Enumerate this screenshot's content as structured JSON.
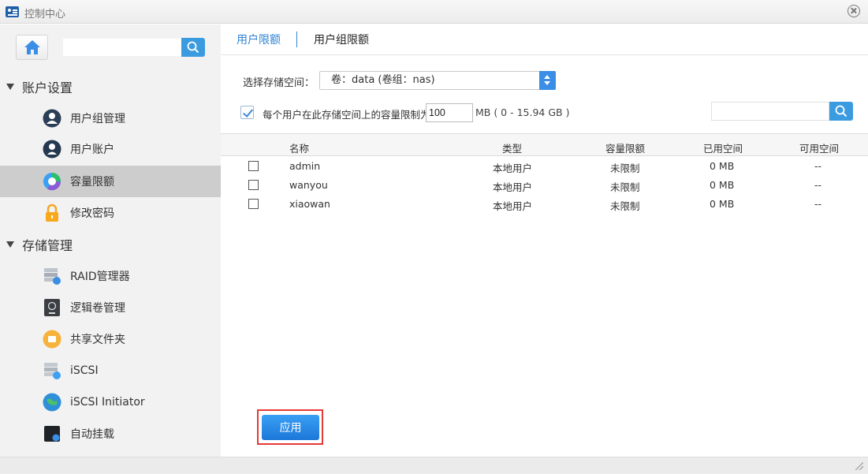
{
  "window": {
    "title": "控制中心"
  },
  "sidebar": {
    "search_placeholder": "",
    "sections": [
      {
        "label": "账户设置",
        "items": [
          {
            "label": "用户组管理",
            "icon": "user-group-icon"
          },
          {
            "label": "用户账户",
            "icon": "user-account-icon"
          },
          {
            "label": "容量限额",
            "icon": "quota-pie-icon",
            "active": true
          },
          {
            "label": "修改密码",
            "icon": "lock-icon"
          }
        ]
      },
      {
        "label": "存储管理",
        "items": [
          {
            "label": "RAID管理器",
            "icon": "raid-icon"
          },
          {
            "label": "逻辑卷管理",
            "icon": "lvm-icon"
          },
          {
            "label": "共享文件夹",
            "icon": "shared-folder-icon"
          },
          {
            "label": "iSCSI",
            "icon": "iscsi-icon"
          },
          {
            "label": "iSCSI Initiator",
            "icon": "iscsi-initiator-icon"
          },
          {
            "label": "自动挂载",
            "icon": "automount-icon"
          }
        ]
      }
    ]
  },
  "tabs": [
    {
      "label": "用户限额",
      "active": true
    },
    {
      "label": "用户组限额",
      "active": false
    }
  ],
  "form": {
    "storage_label": "选择存储空间：",
    "storage_value": "卷：data (卷组：nas)",
    "limit_label": "每个用户在此存储空间上的容量限制为",
    "limit_value": "100",
    "limit_range": "MB ( 0 - 15.94 GB )",
    "limit_checked": true,
    "search_placeholder": ""
  },
  "table": {
    "headers": [
      "名称",
      "类型",
      "容量限额",
      "已用空间",
      "可用空间"
    ],
    "rows": [
      [
        "admin",
        "本地用户",
        "未限制",
        "0 MB",
        "--"
      ],
      [
        "wanyou",
        "本地用户",
        "未限制",
        "0 MB",
        "--"
      ],
      [
        "xiaowan",
        "本地用户",
        "未限制",
        "0 MB",
        "--"
      ]
    ]
  },
  "actions": {
    "apply_label": "应用"
  },
  "colors": {
    "accent": "#2e83d3",
    "button": "#1c77d8",
    "highlight": "#e53935",
    "sidebar_bg": "#f2f2f2",
    "active_item": "#cdcdcd"
  }
}
